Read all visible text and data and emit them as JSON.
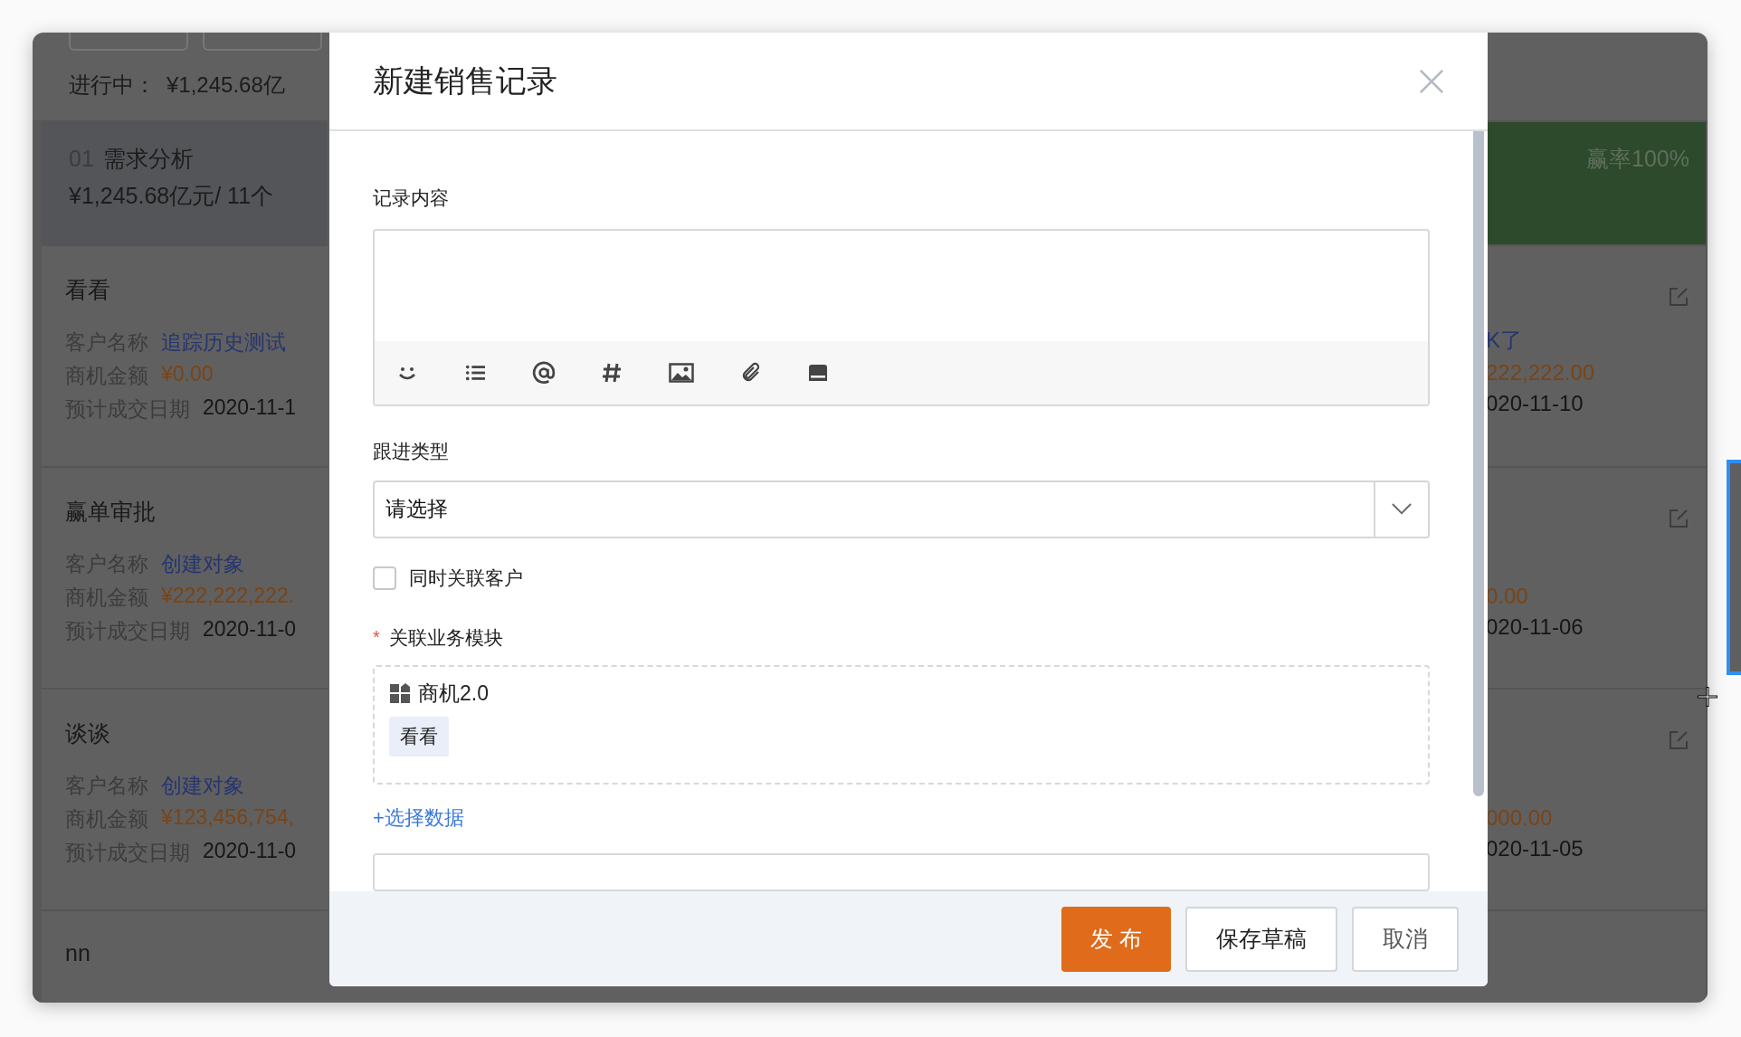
{
  "summary": {
    "label": "进行中：",
    "amount": "¥1,245.68亿"
  },
  "left_column": {
    "header": {
      "index": "01",
      "name": "需求分析",
      "total": "¥1,245.68亿元/ 11个"
    },
    "cards": [
      {
        "title": "看看",
        "fields": [
          {
            "label": "客户名称",
            "value": "追踪历史测试",
            "kind": "link"
          },
          {
            "label": "商机金额",
            "value": "¥0.00",
            "kind": "amount"
          },
          {
            "label": "预计成交日期",
            "value": "2020-11-1",
            "kind": "date"
          }
        ]
      },
      {
        "title": "赢单审批",
        "fields": [
          {
            "label": "客户名称",
            "value": "创建对象",
            "kind": "link"
          },
          {
            "label": "商机金额",
            "value": "¥222,222,222.",
            "kind": "amount"
          },
          {
            "label": "预计成交日期",
            "value": "2020-11-0",
            "kind": "date"
          }
        ]
      },
      {
        "title": "谈谈",
        "fields": [
          {
            "label": "客户名称",
            "value": "创建对象",
            "kind": "link"
          },
          {
            "label": "商机金额",
            "value": "¥123,456,754,",
            "kind": "amount"
          },
          {
            "label": "预计成交日期",
            "value": "2020-11-0",
            "kind": "date"
          }
        ]
      },
      {
        "title": "nn"
      }
    ]
  },
  "right_column": {
    "header": {
      "win_rate": "赢率100%"
    },
    "cards": [
      {
        "values": [
          {
            "text": "K了",
            "kind": "link"
          },
          {
            "text": "222,222.00",
            "kind": "amount"
          },
          {
            "text": "020-11-10",
            "kind": "date"
          }
        ]
      },
      {
        "values": [
          {
            "text": "0.00",
            "kind": "amount"
          },
          {
            "text": "020-11-06",
            "kind": "date"
          }
        ]
      },
      {
        "values": [
          {
            "text": "000.00",
            "kind": "amount"
          },
          {
            "text": "020-11-05",
            "kind": "date"
          }
        ]
      }
    ]
  },
  "dialog": {
    "title": "新建销售记录",
    "content_label": "记录内容",
    "follow_type": {
      "label": "跟进类型",
      "placeholder": "请选择"
    },
    "link_customer": {
      "label": "同时关联客户",
      "checked": false
    },
    "module": {
      "label": "关联业务模块",
      "required_mark": "*",
      "name": "商机2.0",
      "tags": [
        "看看"
      ],
      "add_link": "+选择数据"
    },
    "buttons": [
      {
        "label": "发 布",
        "kind": "primary"
      },
      {
        "label": "保存草稿",
        "kind": "default"
      },
      {
        "label": "取消",
        "kind": "default"
      }
    ]
  }
}
